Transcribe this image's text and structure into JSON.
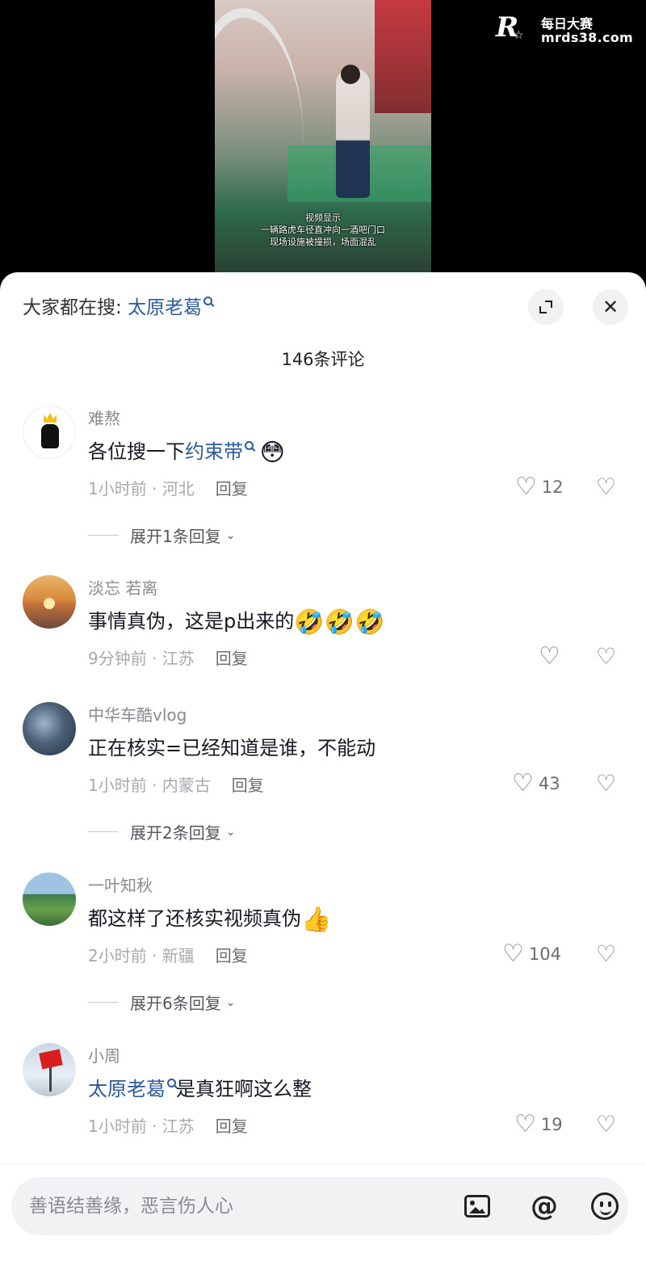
{
  "watermark": {
    "title": "每日大赛",
    "url": "mrds38.com"
  },
  "video": {
    "caption_line1": "视频显示",
    "caption_line2": "一辆路虎车径直冲向一酒吧门口",
    "caption_line3": "现场设施被撞损，场面混乱"
  },
  "header": {
    "search_prefix": "大家都在搜:",
    "search_term": "太原老葛",
    "close_symbol": "✕"
  },
  "comment_count": "146条评论",
  "comments": [
    {
      "nick": "难熬",
      "text_before": "各位搜一下",
      "link": "约束带",
      "text_after": "",
      "emoji": "😳",
      "time_location": "1小时前 · 河北",
      "reply": "回复",
      "likes": "12",
      "expand": "展开1条回复"
    },
    {
      "nick": "淡忘  若离",
      "text_before": "事情真伪，这是p出来的",
      "link": "",
      "text_after": "",
      "emoji": "🤣🤣🤣",
      "time_location": "9分钟前 · 江苏",
      "reply": "回复",
      "likes": "",
      "expand": ""
    },
    {
      "nick": "中华车酷vlog",
      "text_before": "正在核实=已经知道是谁，不能动",
      "link": "",
      "text_after": "",
      "emoji": "",
      "time_location": "1小时前 · 内蒙古",
      "reply": "回复",
      "likes": "43",
      "expand": "展开2条回复"
    },
    {
      "nick": "一叶知秋",
      "text_before": "都这样了还核实视频真伪",
      "link": "",
      "text_after": "",
      "emoji": "👍",
      "time_location": "2小时前 · 新疆",
      "reply": "回复",
      "likes": "104",
      "expand": "展开6条回复"
    },
    {
      "nick": "小周",
      "text_before": "",
      "link": "太原老葛",
      "text_after": "是真狂啊这么整",
      "emoji": "",
      "time_location": "1小时前 · 江苏",
      "reply": "回复",
      "likes": "19",
      "expand": ""
    }
  ],
  "input": {
    "placeholder": "善语结善缘，恶言伤人心"
  },
  "icons": {
    "image": "image-icon",
    "mention": "at-icon",
    "emoji": "smile-icon",
    "like": "heart-icon",
    "dislike": "broken-heart-icon"
  },
  "symbols": {
    "at": "@",
    "heart": "♡",
    "chevron": "⌄"
  }
}
